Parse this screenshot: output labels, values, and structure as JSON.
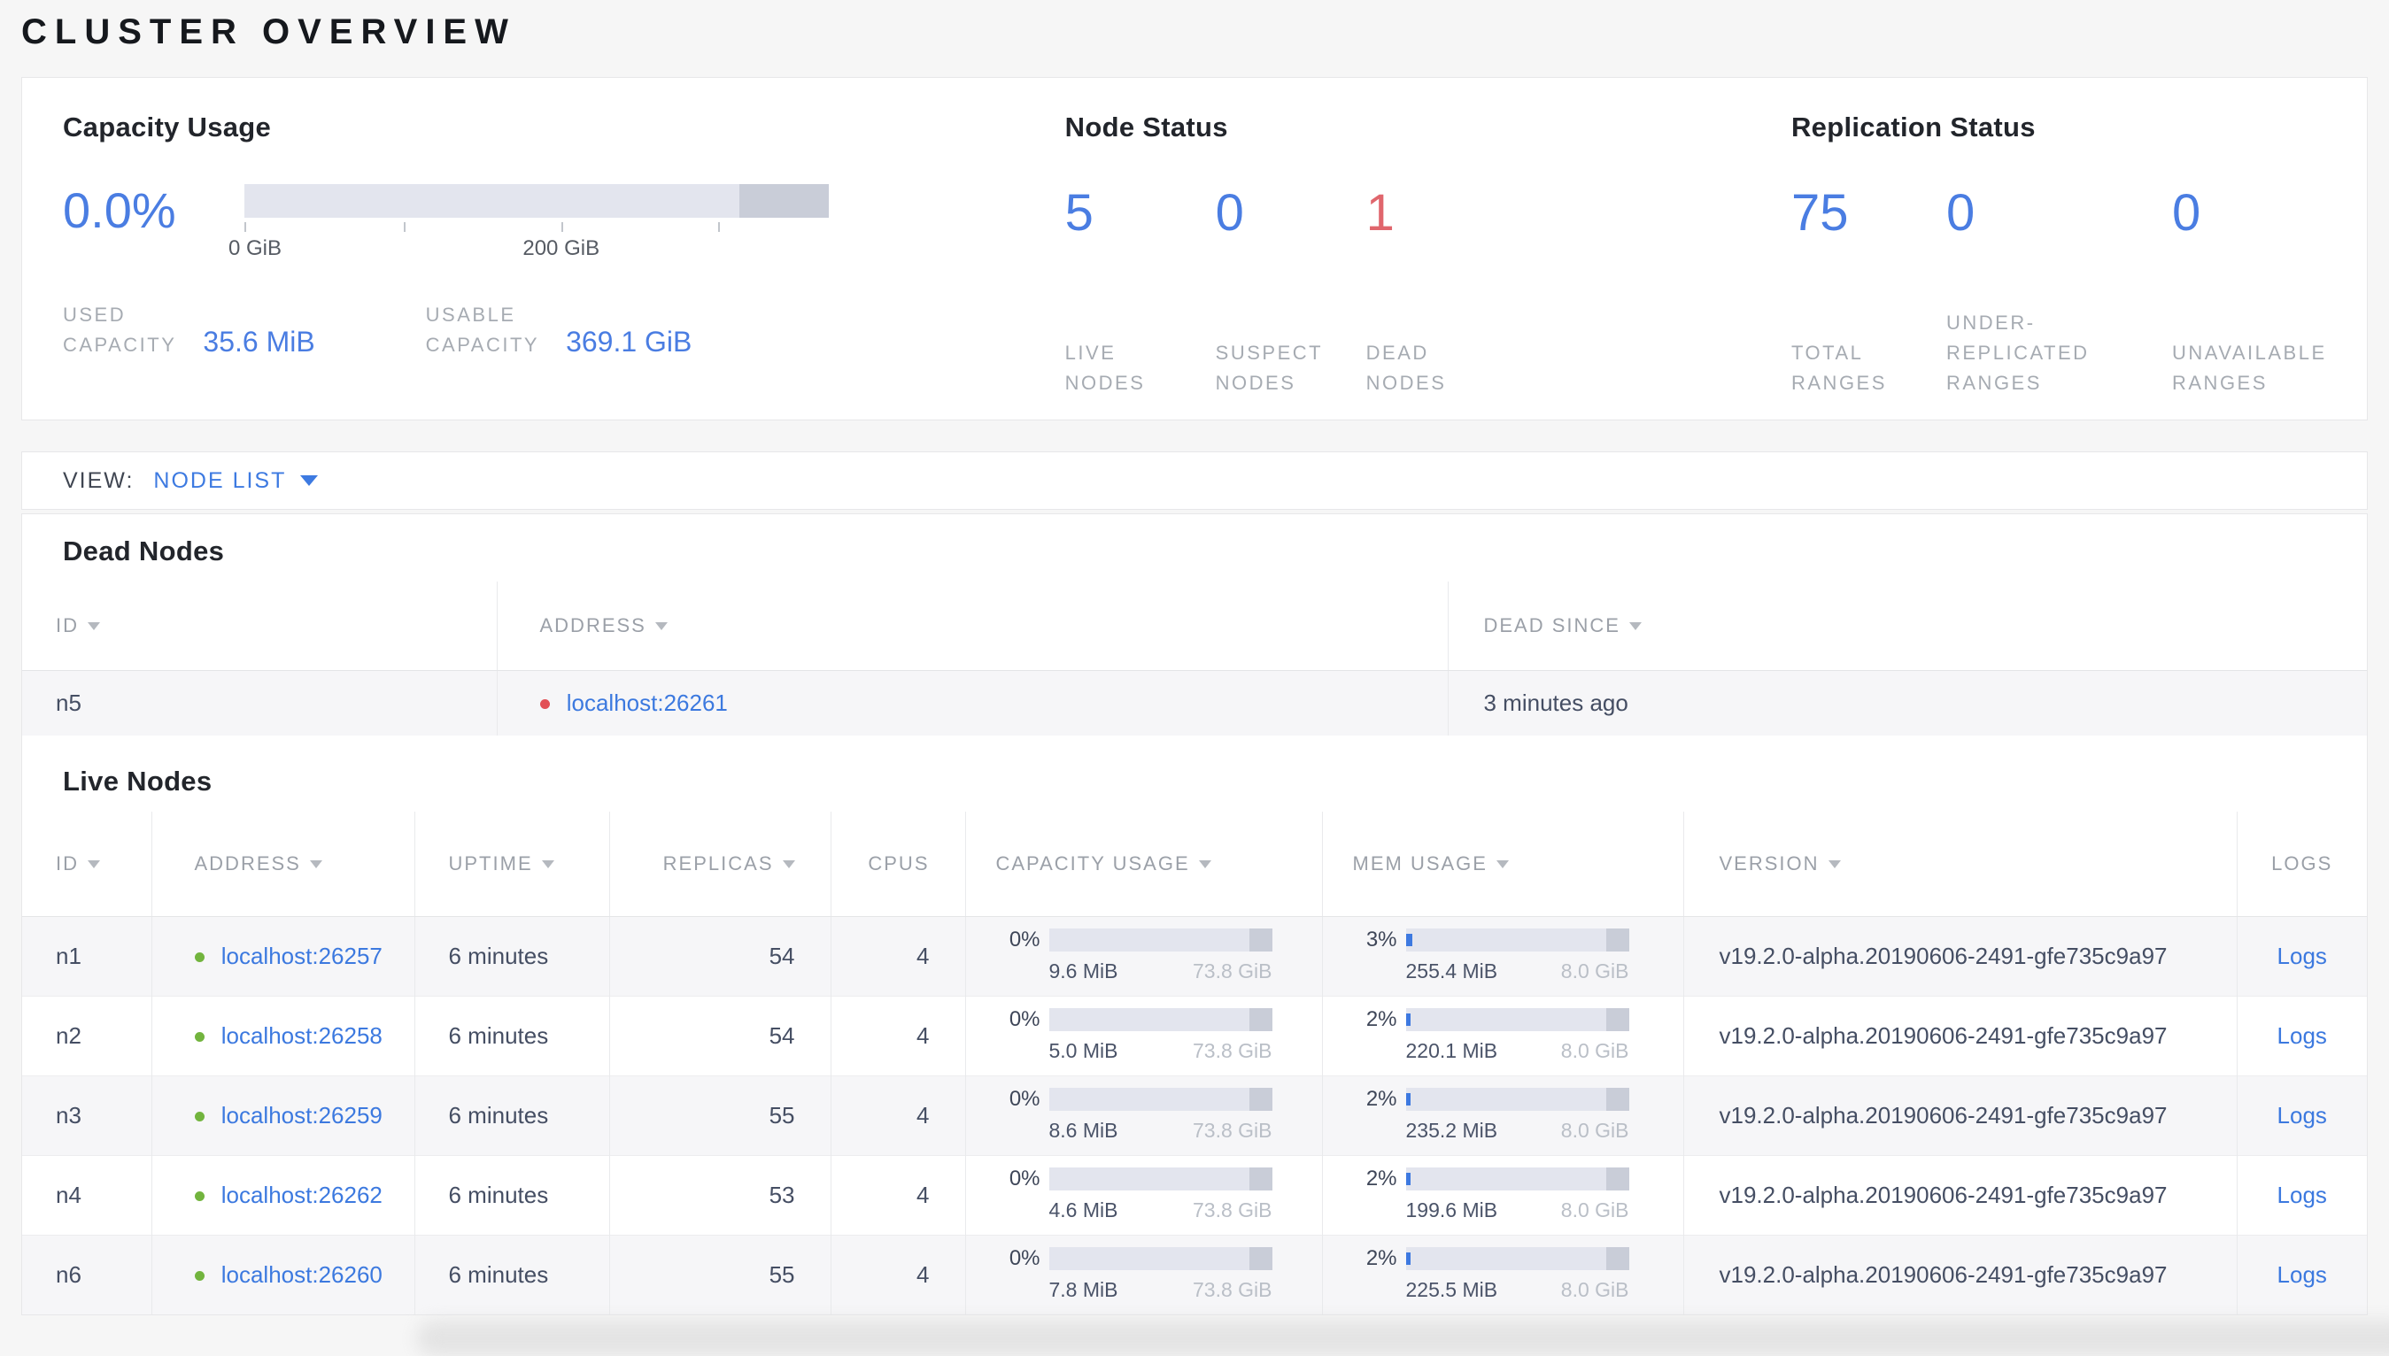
{
  "page": {
    "title": "CLUSTER OVERVIEW"
  },
  "colors": {
    "accent_blue": "#4a7de2",
    "link_blue": "#3c79df",
    "dead_red": "#e0666d",
    "dead_dot_red": "#e24f55",
    "live_dot_green": "#72b43e",
    "bar_track": "#e3e5ee",
    "bar_capacity_segment": "#c9cdd8"
  },
  "summary": {
    "capacity": {
      "title": "Capacity Usage",
      "percent": "0.0%",
      "percent_num": 0,
      "axis_ticks": [
        "0 GiB",
        "200 GiB"
      ],
      "stats": [
        {
          "label": "USED\nCAPACITY",
          "value": "35.6 MiB"
        },
        {
          "label": "USABLE\nCAPACITY",
          "value": "369.1 GiB"
        }
      ]
    },
    "node_status": {
      "title": "Node Status",
      "stats": [
        {
          "value": "5",
          "label": "LIVE\nNODES"
        },
        {
          "value": "0",
          "label": "SUSPECT\nNODES"
        },
        {
          "value": "1",
          "label": "DEAD\nNODES"
        }
      ]
    },
    "replication": {
      "title": "Replication Status",
      "stats": [
        {
          "value": "75",
          "label": "TOTAL\nRANGES"
        },
        {
          "value": "0",
          "label": "UNDER-\nREPLICATED\nRANGES"
        },
        {
          "value": "0",
          "label": "UNAVAILABLE\nRANGES"
        }
      ]
    }
  },
  "view_bar": {
    "label": "VIEW:",
    "selected": "NODE LIST"
  },
  "dead_nodes": {
    "title": "Dead Nodes",
    "columns": [
      {
        "label": "ID"
      },
      {
        "label": "ADDRESS"
      },
      {
        "label": "DEAD SINCE"
      }
    ],
    "rows": [
      {
        "id": "n5",
        "address": "localhost:26261",
        "dead_since": "3 minutes ago"
      }
    ]
  },
  "live_nodes": {
    "title": "Live Nodes",
    "columns": [
      {
        "label": "ID"
      },
      {
        "label": "ADDRESS"
      },
      {
        "label": "UPTIME"
      },
      {
        "label": "REPLICAS"
      },
      {
        "label": "CPUS"
      },
      {
        "label": "CAPACITY USAGE"
      },
      {
        "label": "MEM USAGE"
      },
      {
        "label": "VERSION"
      },
      {
        "label": "LOGS"
      }
    ],
    "rows": [
      {
        "id": "n1",
        "address": "localhost:26257",
        "uptime": "6 minutes",
        "replicas": "54",
        "cpus": "4",
        "capacity": {
          "percent": "0%",
          "percent_num": 0,
          "used": "9.6 MiB",
          "total": "73.8 GiB"
        },
        "mem": {
          "percent": "3%",
          "percent_num": 3,
          "used": "255.4 MiB",
          "total": "8.0 GiB"
        },
        "version": "v19.2.0-alpha.20190606-2491-gfe735c9a97",
        "logs": "Logs"
      },
      {
        "id": "n2",
        "address": "localhost:26258",
        "uptime": "6 minutes",
        "replicas": "54",
        "cpus": "4",
        "capacity": {
          "percent": "0%",
          "percent_num": 0,
          "used": "5.0 MiB",
          "total": "73.8 GiB"
        },
        "mem": {
          "percent": "2%",
          "percent_num": 2,
          "used": "220.1 MiB",
          "total": "8.0 GiB"
        },
        "version": "v19.2.0-alpha.20190606-2491-gfe735c9a97",
        "logs": "Logs"
      },
      {
        "id": "n3",
        "address": "localhost:26259",
        "uptime": "6 minutes",
        "replicas": "55",
        "cpus": "4",
        "capacity": {
          "percent": "0%",
          "percent_num": 0,
          "used": "8.6 MiB",
          "total": "73.8 GiB"
        },
        "mem": {
          "percent": "2%",
          "percent_num": 2,
          "used": "235.2 MiB",
          "total": "8.0 GiB"
        },
        "version": "v19.2.0-alpha.20190606-2491-gfe735c9a97",
        "logs": "Logs"
      },
      {
        "id": "n4",
        "address": "localhost:26262",
        "uptime": "6 minutes",
        "replicas": "53",
        "cpus": "4",
        "capacity": {
          "percent": "0%",
          "percent_num": 0,
          "used": "4.6 MiB",
          "total": "73.8 GiB"
        },
        "mem": {
          "percent": "2%",
          "percent_num": 2,
          "used": "199.6 MiB",
          "total": "8.0 GiB"
        },
        "version": "v19.2.0-alpha.20190606-2491-gfe735c9a97",
        "logs": "Logs"
      },
      {
        "id": "n6",
        "address": "localhost:26260",
        "uptime": "6 minutes",
        "replicas": "55",
        "cpus": "4",
        "capacity": {
          "percent": "0%",
          "percent_num": 0,
          "used": "7.8 MiB",
          "total": "73.8 GiB"
        },
        "mem": {
          "percent": "2%",
          "percent_num": 2,
          "used": "225.5 MiB",
          "total": "8.0 GiB"
        },
        "version": "v19.2.0-alpha.20190606-2491-gfe735c9a97",
        "logs": "Logs"
      }
    ]
  }
}
